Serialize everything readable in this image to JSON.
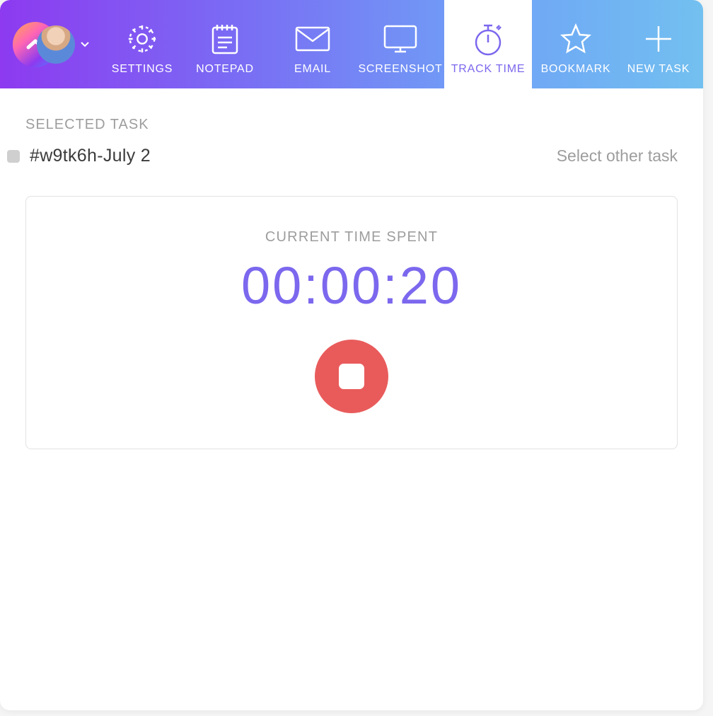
{
  "toolbar": {
    "tabs": [
      {
        "label": "SETTINGS",
        "icon": "gear-icon",
        "active": false
      },
      {
        "label": "NOTEPAD",
        "icon": "notepad-icon",
        "active": false
      },
      {
        "label": "EMAIL",
        "icon": "email-icon",
        "active": false
      },
      {
        "label": "SCREENSHOT",
        "icon": "screenshot-icon",
        "active": false
      },
      {
        "label": "TRACK TIME",
        "icon": "stopwatch-icon",
        "active": true
      },
      {
        "label": "BOOKMARK",
        "icon": "star-icon",
        "active": false
      },
      {
        "label": "NEW TASK",
        "icon": "plus-icon",
        "active": false
      }
    ]
  },
  "selected_task": {
    "header": "SELECTED TASK",
    "task_name": "#w9tk6h-July 2",
    "select_other_label": "Select other task"
  },
  "timer": {
    "label": "CURRENT TIME SPENT",
    "value": "00:00:20"
  },
  "colors": {
    "accent": "#7b68ee",
    "stop_button": "#e95b5b"
  }
}
